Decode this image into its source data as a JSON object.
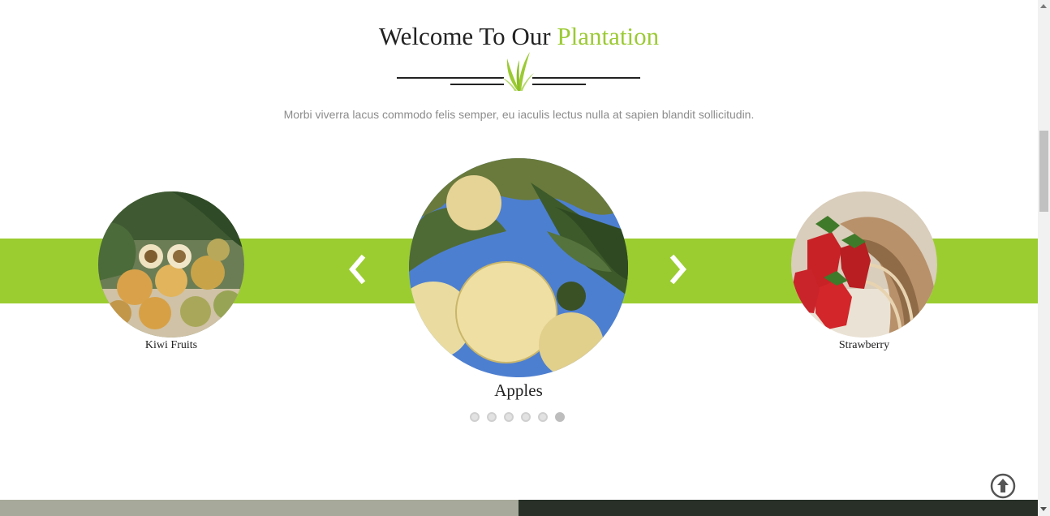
{
  "header": {
    "title_main": "Welcome To Our",
    "title_accent": "Plantation",
    "subtitle": "Morbi viverra lacus commodo felis semper, eu iaculis lectus nulla at sapien blandit sollicitudin."
  },
  "carousel": {
    "slides": [
      {
        "label": "Kiwi Fruits",
        "image": "kiwi-fruits-photo"
      },
      {
        "label": "Apples",
        "image": "apples-photo"
      },
      {
        "label": "Strawberry",
        "image": "strawberry-photo"
      }
    ],
    "prev_icon": "chevron-left-icon",
    "next_icon": "chevron-right-icon",
    "dot_count": 6,
    "active_dot": 6
  },
  "colors": {
    "accent": "#9bca33",
    "band": "#9bcd30",
    "title_text": "#222222",
    "subtitle_text": "#8c8c8c"
  },
  "scroll_top_icon": "arrow-up-circle-icon"
}
